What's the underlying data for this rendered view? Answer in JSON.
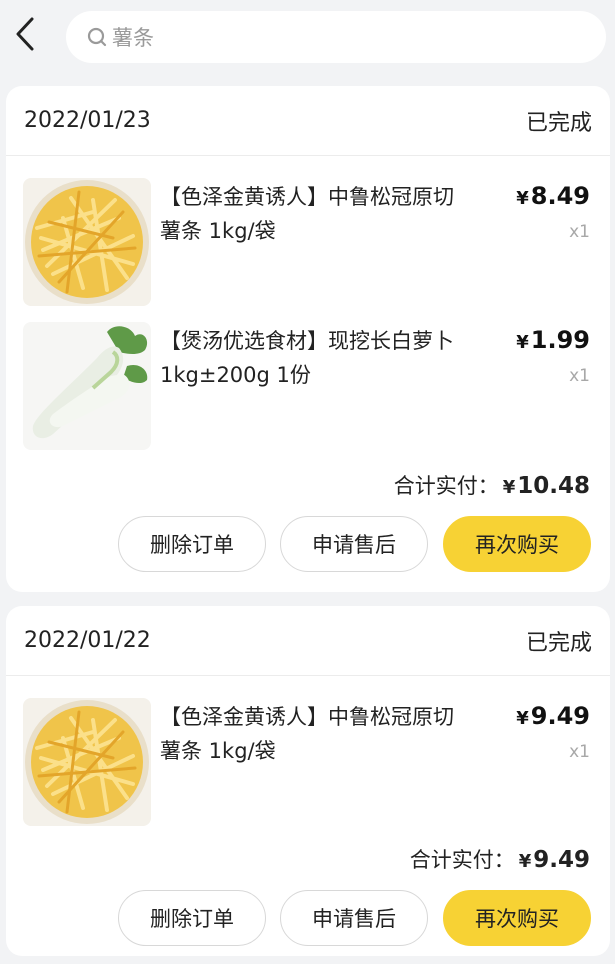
{
  "header": {
    "search_text": "薯条"
  },
  "orders": [
    {
      "date": "2022/01/23",
      "status": "已完成",
      "items": [
        {
          "title_line1": "【色泽金黄诱人】中鲁松冠原切",
          "title_line2": "薯条 1kg/袋",
          "price": "8.49",
          "qty": "x1",
          "image": "french-fries"
        },
        {
          "title_line1": "【煲汤优选食材】现挖长白萝卜",
          "title_line2": "1kg±200g 1份",
          "price": "1.99",
          "qty": "x1",
          "image": "white-radish"
        }
      ],
      "total_label": "合计实付：",
      "total": "10.48",
      "buttons": {
        "delete": "删除订单",
        "after_sale": "申请售后",
        "rebuy": "再次购买"
      }
    },
    {
      "date": "2022/01/22",
      "status": "已完成",
      "items": [
        {
          "title_line1": "【色泽金黄诱人】中鲁松冠原切",
          "title_line2": "薯条 1kg/袋",
          "price": "9.49",
          "qty": "x1",
          "image": "french-fries"
        }
      ],
      "total_label": "合计实付：",
      "total": "9.49",
      "buttons": {
        "delete": "删除订单",
        "after_sale": "申请售后",
        "rebuy": "再次购买"
      }
    }
  ],
  "currency_symbol": "¥",
  "colors": {
    "accent": "#f7d234",
    "background": "#f2f3f5"
  }
}
